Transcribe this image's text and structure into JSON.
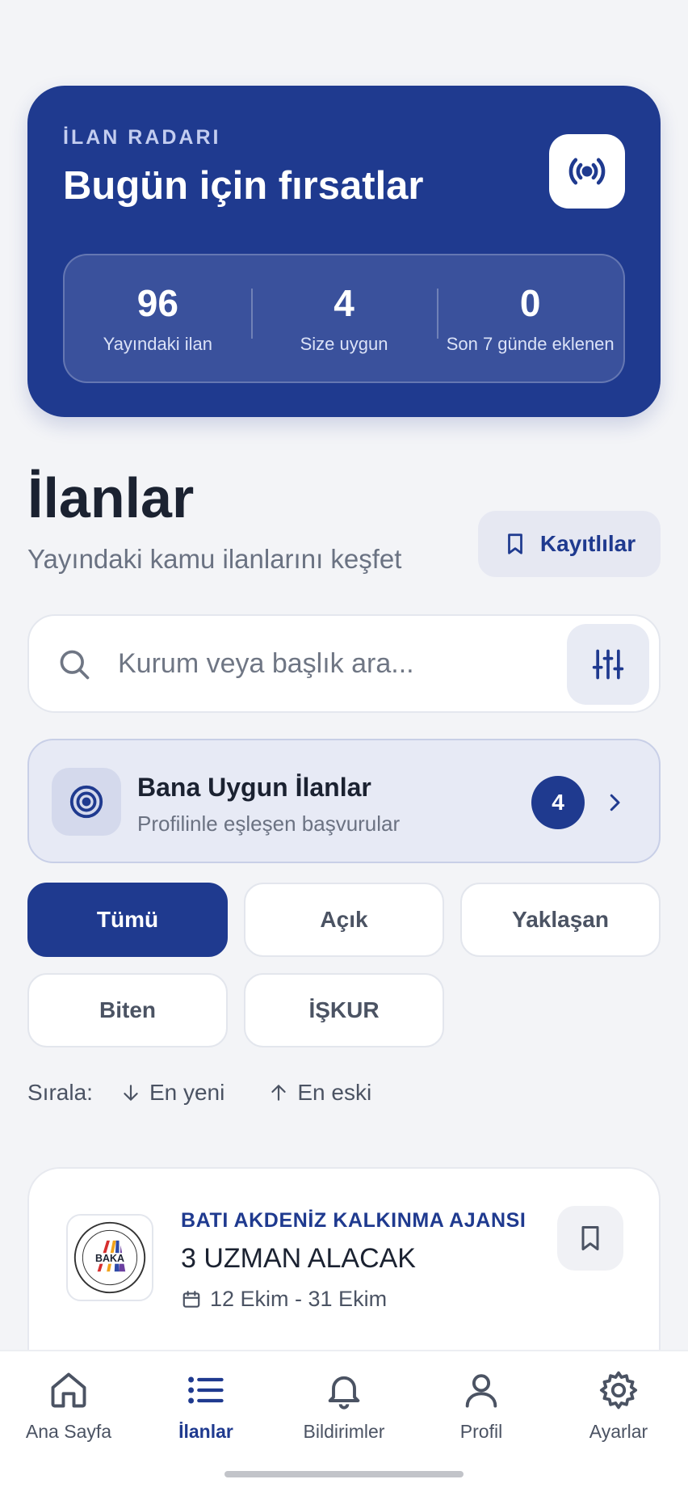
{
  "hero": {
    "eyebrow": "İLAN RADARI",
    "title": "Bugün için fırsatlar",
    "icon": "broadcast-radar-icon",
    "stats": [
      {
        "value": "96",
        "label": "Yayındaki ilan"
      },
      {
        "value": "4",
        "label": "Size uygun"
      },
      {
        "value": "0",
        "label": "Son 7 günde eklenen"
      }
    ]
  },
  "header": {
    "title": "İlanlar",
    "subtitle": "Yayındaki kamu ilanlarını keşfet",
    "saved_label": "Kayıtlılar"
  },
  "search": {
    "placeholder": "Kurum veya başlık ara..."
  },
  "match_card": {
    "title": "Bana Uygun İlanlar",
    "subtitle": "Profilinle eşleşen başvurular",
    "count": "4"
  },
  "filters": {
    "chips": [
      "Tümü",
      "Açık",
      "Yaklaşan",
      "Biten",
      "İŞKUR"
    ],
    "active": "Tümü"
  },
  "sort": {
    "label": "Sırala:",
    "newest": "En yeni",
    "oldest": "En eski"
  },
  "listings": [
    {
      "organization": "BATI AKDENİZ KALKINMA AJANSI",
      "title": "3 UZMAN ALACAK",
      "dates": "12 Ekim - 31 Ekim",
      "logo_text": "BAKA"
    }
  ],
  "nav": {
    "items": [
      "Ana Sayfa",
      "İlanlar",
      "Bildirimler",
      "Profil",
      "Ayarlar"
    ],
    "active": "İlanlar"
  },
  "colors": {
    "primary": "#1f3a8f",
    "background": "#f3f4f7"
  }
}
